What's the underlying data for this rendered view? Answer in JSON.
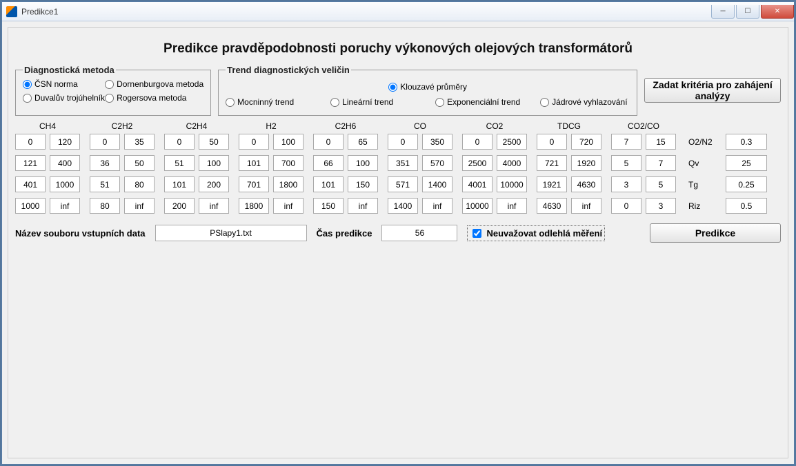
{
  "window": {
    "title": "Predikce1"
  },
  "heading": "Predikce pravděpodobnosti poruchy výkonových olejových transformátorů",
  "diag": {
    "legend": "Diagnostická metoda",
    "opts": {
      "csn": {
        "label": "ČSN norma",
        "checked": true
      },
      "dorn": {
        "label": "Dornenburgova metoda",
        "checked": false
      },
      "duval": {
        "label": "Duvalův trojúhelník",
        "checked": false
      },
      "rogers": {
        "label": "Rogersova metoda",
        "checked": false
      }
    }
  },
  "trend": {
    "legend": "Trend diagnostických veličin",
    "opts": {
      "klouz": {
        "label": "Klouzavé průměry",
        "checked": true
      },
      "mocn": {
        "label": "Mocninný trend",
        "checked": false
      },
      "lin": {
        "label": "Lineární trend",
        "checked": false
      },
      "exp": {
        "label": "Exponenciální trend",
        "checked": false
      },
      "jadr": {
        "label": "Jádrové vyhlazování",
        "checked": false
      }
    }
  },
  "main_button": "Zadat kritéria pro zahájení analýzy",
  "gases": [
    {
      "name": "CH4",
      "rows": [
        [
          "0",
          "120"
        ],
        [
          "121",
          "400"
        ],
        [
          "401",
          "1000"
        ],
        [
          "1000",
          "inf"
        ]
      ]
    },
    {
      "name": "C2H2",
      "rows": [
        [
          "0",
          "35"
        ],
        [
          "36",
          "50"
        ],
        [
          "51",
          "80"
        ],
        [
          "80",
          "inf"
        ]
      ]
    },
    {
      "name": "C2H4",
      "rows": [
        [
          "0",
          "50"
        ],
        [
          "51",
          "100"
        ],
        [
          "101",
          "200"
        ],
        [
          "200",
          "inf"
        ]
      ]
    },
    {
      "name": "H2",
      "rows": [
        [
          "0",
          "100"
        ],
        [
          "101",
          "700"
        ],
        [
          "701",
          "1800"
        ],
        [
          "1800",
          "inf"
        ]
      ]
    },
    {
      "name": "C2H6",
      "rows": [
        [
          "0",
          "65"
        ],
        [
          "66",
          "100"
        ],
        [
          "101",
          "150"
        ],
        [
          "150",
          "inf"
        ]
      ]
    },
    {
      "name": "CO",
      "rows": [
        [
          "0",
          "350"
        ],
        [
          "351",
          "570"
        ],
        [
          "571",
          "1400"
        ],
        [
          "1400",
          "inf"
        ]
      ]
    },
    {
      "name": "CO2",
      "rows": [
        [
          "0",
          "2500"
        ],
        [
          "2500",
          "4000"
        ],
        [
          "4001",
          "10000"
        ],
        [
          "10000",
          "inf"
        ]
      ]
    },
    {
      "name": "TDCG",
      "rows": [
        [
          "0",
          "720"
        ],
        [
          "721",
          "1920"
        ],
        [
          "1921",
          "4630"
        ],
        [
          "4630",
          "inf"
        ]
      ]
    },
    {
      "name": "CO2/CO",
      "rows": [
        [
          "7",
          "15"
        ],
        [
          "5",
          "7"
        ],
        [
          "3",
          "5"
        ],
        [
          "0",
          "3"
        ]
      ]
    }
  ],
  "ratios": [
    {
      "label": "O2/N2",
      "value": "0.3"
    },
    {
      "label": "Qv",
      "value": "25"
    },
    {
      "label": "Tg",
      "value": "0.25"
    },
    {
      "label": "Riz",
      "value": "0.5"
    }
  ],
  "bottom": {
    "file_label": "Název souboru vstupních data",
    "file_value": "PSlapy1.txt",
    "time_label": "Čas predikce",
    "time_value": "56",
    "check_label": "Neuvažovat odlehlá měření",
    "check_checked": true,
    "predict_label": "Predikce"
  }
}
